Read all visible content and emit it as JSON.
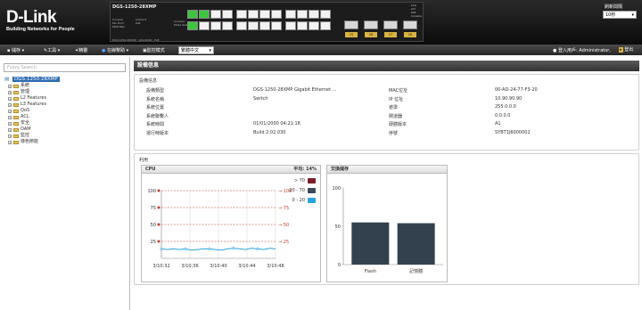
{
  "header": {
    "brand": "D-Link",
    "tagline": "Building Networks for People",
    "model": "DGS-1250-28XMP",
    "model_sub": "DGS-1250-28XMP · 10G/1000 · PoE",
    "leds_left": [
      "Console",
      "Fan Error",
      "PWR Max"
    ],
    "leds_mid": [
      "Link/Act",
      "PoE"
    ],
    "leds_mid2": [
      "Console",
      "Mode Select"
    ],
    "sfp_labels": [
      "25",
      "26",
      "27",
      "28"
    ],
    "legend_leds": [
      "Link",
      "Act",
      "PoE",
      "Console"
    ],
    "refresh_label": "刷新間隔",
    "refresh_value": "10秒"
  },
  "toolbar": {
    "save": "儲存",
    "tools": "工具",
    "wizard": "精靈",
    "online_help": "在線幫助",
    "monitor_mode": "監控模式",
    "language": "繁體中文",
    "user": "登入用戶: Administrator,",
    "logout": "登出"
  },
  "sidebar": {
    "search_placeholder": "Fuzzy Search",
    "root": "DGS-1250-28XMP",
    "items": [
      {
        "label": "系統"
      },
      {
        "label": "管理"
      },
      {
        "label": "L2 Features"
      },
      {
        "label": "L3 Features"
      },
      {
        "label": "QoS"
      },
      {
        "label": "ACL"
      },
      {
        "label": "安全"
      },
      {
        "label": "OAM"
      },
      {
        "label": "監控"
      },
      {
        "label": "綠色節能"
      }
    ]
  },
  "main": {
    "title": "設備信息",
    "device_info": {
      "title": "設備信息",
      "left": [
        {
          "label": "設備類型",
          "value": "DGS-1250-28XMP Gigabit Ethernet ..."
        },
        {
          "label": "系統名稱",
          "value": "Switch"
        },
        {
          "label": "系統位置",
          "value": ""
        },
        {
          "label": "系統聯繫人",
          "value": ""
        },
        {
          "label": "系統時間",
          "value": "01/01/2000 04:21:18"
        },
        {
          "label": "運行時版本",
          "value": "Build 2.02.030"
        }
      ],
      "right": [
        {
          "label": "MAC位址",
          "value": "00-AD-24-77-F3-20"
        },
        {
          "label": "IP 位址",
          "value": "10.90.90.90"
        },
        {
          "label": "遮罩",
          "value": "255.0.0.0"
        },
        {
          "label": "閘道器",
          "value": "0.0.0.0"
        },
        {
          "label": "硬體版本",
          "value": "A1"
        },
        {
          "label": "序號",
          "value": "SYBT1J6000002"
        }
      ]
    },
    "usage_title": "利用",
    "cpu": {
      "title": "CPU",
      "avg": "平均: 14%",
      "legend": [
        {
          "label": "> 70",
          "color": "#7a1f2b"
        },
        {
          "label": "20 - 70",
          "color": "#3a4a5a"
        },
        {
          "label": "0 - 20",
          "color": "#29a3e0"
        }
      ],
      "thresholds": [
        "100",
        "75",
        "50",
        "25"
      ],
      "right_thresholds": [
        "100",
        "75",
        "50",
        "25"
      ]
    },
    "memory": {
      "title": "交換儲存"
    }
  },
  "chart_data": [
    {
      "type": "line",
      "title": "CPU",
      "x": [
        "3/10:32",
        "3/10:36",
        "3/10:40",
        "3/10:44",
        "3/10:48"
      ],
      "y_ticks": [
        0,
        25,
        50,
        75,
        100
      ],
      "ylim": [
        0,
        100
      ],
      "series": [
        {
          "values": [
            14,
            13,
            14,
            13,
            14,
            12,
            13,
            14,
            14,
            13,
            12,
            14,
            15,
            14,
            13,
            15,
            14,
            13,
            15,
            14
          ],
          "color": "#29a3e0"
        }
      ],
      "threshold_lines": [
        100,
        75,
        50,
        25
      ],
      "legend": [
        "> 70",
        "20 - 70",
        "0 - 20"
      ]
    },
    {
      "type": "bar",
      "title": "交換儲存",
      "categories": [
        "Flash",
        "記憶體"
      ],
      "values": [
        55,
        54
      ],
      "y_ticks": [
        0,
        50,
        100
      ],
      "ylim": [
        0,
        100
      ],
      "color": "#33414f"
    }
  ]
}
